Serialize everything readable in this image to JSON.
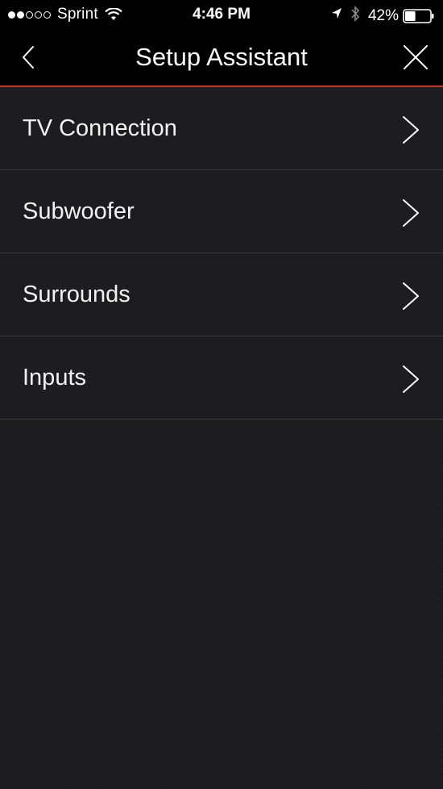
{
  "status_bar": {
    "carrier": "Sprint",
    "signal_bars_filled": 2,
    "signal_bars_total": 5,
    "time": "4:46 PM",
    "battery_percent": "42%",
    "battery_level": 0.42,
    "icons": [
      "wifi-icon",
      "location-arrow-icon",
      "bluetooth-icon",
      "battery-icon"
    ]
  },
  "nav": {
    "title": "Setup Assistant",
    "back_icon": "chevron-left-icon",
    "close_icon": "close-icon",
    "accent_color": "#c6361e"
  },
  "menu": {
    "items": [
      {
        "label": "TV Connection",
        "icon": "chevron-right-icon"
      },
      {
        "label": "Subwoofer",
        "icon": "chevron-right-icon"
      },
      {
        "label": "Surrounds",
        "icon": "chevron-right-icon"
      },
      {
        "label": "Inputs",
        "icon": "chevron-right-icon"
      }
    ]
  }
}
